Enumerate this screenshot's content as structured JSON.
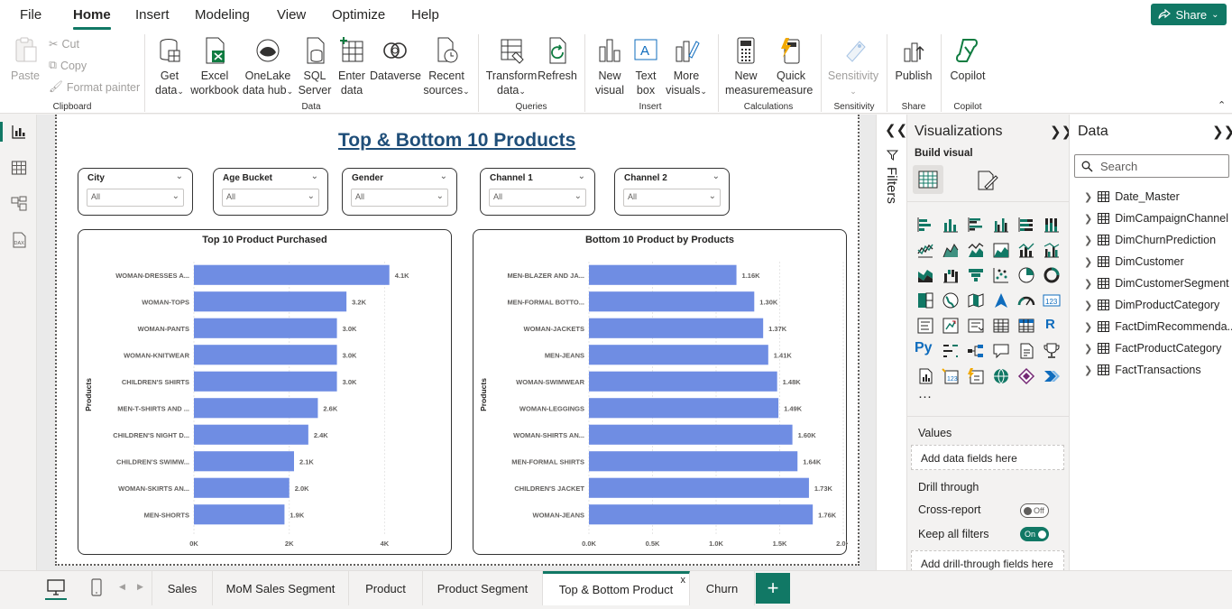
{
  "menu": {
    "items": [
      "File",
      "Home",
      "Insert",
      "Modeling",
      "View",
      "Optimize",
      "Help"
    ],
    "active": "Home",
    "share_label": "Share"
  },
  "ribbon": {
    "clipboard": {
      "paste": "Paste",
      "cut": "Cut",
      "copy": "Copy",
      "format_painter": "Format painter",
      "group": "Clipboard"
    },
    "data": {
      "get_data": [
        "Get",
        "data"
      ],
      "excel": [
        "Excel",
        "workbook"
      ],
      "onelake": [
        "OneLake",
        "data hub"
      ],
      "sql": [
        "SQL",
        "Server"
      ],
      "enter": [
        "Enter",
        "data"
      ],
      "dataverse": "Dataverse",
      "recent": [
        "Recent",
        "sources"
      ],
      "group": "Data"
    },
    "queries": {
      "transform": [
        "Transform",
        "data"
      ],
      "refresh": "Refresh",
      "group": "Queries"
    },
    "insert": {
      "new_visual": [
        "New",
        "visual"
      ],
      "text_box": [
        "Text",
        "box"
      ],
      "more_visuals": [
        "More",
        "visuals"
      ],
      "group": "Insert"
    },
    "calculations": {
      "new_measure": [
        "New",
        "measure"
      ],
      "quick_measure": [
        "Quick",
        "measure"
      ],
      "group": "Calculations"
    },
    "sensitivity": {
      "label": "Sensitivity",
      "group": "Sensitivity"
    },
    "share": {
      "publish": "Publish",
      "group": "Share"
    },
    "copilot": {
      "label": "Copilot",
      "group": "Copilot"
    }
  },
  "report": {
    "title": "Top & Bottom 10 Products",
    "slicers": [
      {
        "label": "City",
        "value": "All"
      },
      {
        "label": "Age Bucket",
        "value": "All"
      },
      {
        "label": "Gender",
        "value": "All"
      },
      {
        "label": "Channel 1",
        "value": "All"
      },
      {
        "label": "Channel 2",
        "value": "All"
      }
    ]
  },
  "chart_data": [
    {
      "type": "bar",
      "orientation": "horizontal",
      "title": "Top 10 Product Purchased",
      "ylabel": "Products",
      "xlabel": "",
      "categories": [
        "WOMAN-DRESSES A...",
        "WOMAN-TOPS",
        "WOMAN-PANTS",
        "WOMAN-KNITWEAR",
        "CHILDREN'S SHIRTS",
        "MEN-T-SHIRTS AND ...",
        "CHILDREN'S NIGHT D...",
        "CHILDREN'S SWIMW...",
        "WOMAN-SKIRTS AN...",
        "MEN-SHORTS"
      ],
      "values": [
        4100,
        3200,
        3000,
        3000,
        3000,
        2600,
        2400,
        2100,
        2000,
        1900
      ],
      "data_labels": [
        "4.1K",
        "3.2K",
        "3.0K",
        "3.0K",
        "3.0K",
        "2.6K",
        "2.4K",
        "2.1K",
        "2.0K",
        "1.9K"
      ],
      "xlim": [
        0,
        4200
      ],
      "ticks": [
        0,
        2000,
        4000
      ],
      "tick_labels": [
        "0K",
        "2K",
        "4K"
      ],
      "color": "#6f8de3"
    },
    {
      "type": "bar",
      "orientation": "horizontal",
      "title": "Bottom 10 Product by Products",
      "ylabel": "Products",
      "xlabel": "",
      "categories": [
        "MEN-BLAZER AND JA...",
        "MEN-FORMAL BOTTO...",
        "WOMAN-JACKETS",
        "MEN-JEANS",
        "WOMAN-SWIMWEAR",
        "WOMAN-LEGGINGS",
        "WOMAN-SHIRTS AN...",
        "MEN-FORMAL SHIRTS",
        "CHILDREN'S JACKET",
        "WOMAN-JEANS"
      ],
      "values": [
        1160,
        1300,
        1370,
        1410,
        1480,
        1490,
        1600,
        1640,
        1730,
        1760
      ],
      "data_labels": [
        "1.16K",
        "1.30K",
        "1.37K",
        "1.41K",
        "1.48K",
        "1.49K",
        "1.60K",
        "1.64K",
        "1.73K",
        "1.76K"
      ],
      "xlim": [
        0,
        2000
      ],
      "ticks": [
        0,
        500,
        1000,
        1500,
        2000
      ],
      "tick_labels": [
        "0.0K",
        "0.5K",
        "1.0K",
        "1.5K",
        "2.0K"
      ],
      "color": "#6f8de3"
    }
  ],
  "filters": {
    "label": "Filters"
  },
  "visualizations": {
    "title": "Visualizations",
    "build_visual": "Build visual",
    "more": "···",
    "values_label": "Values",
    "values_zone": "Add data fields here",
    "drill_label": "Drill through",
    "cross_report": "Cross-report",
    "cross_report_state": "Off",
    "keep_filters": "Keep all filters",
    "keep_filters_state": "On",
    "drill_zone": "Add drill-through fields here"
  },
  "data_pane": {
    "title": "Data",
    "search_placeholder": "Search",
    "tables": [
      "Date_Master",
      "DimCampaignChannel",
      "DimChurnPrediction",
      "DimCustomer",
      "DimCustomerSegment",
      "DimProductCategory",
      "FactDimRecommenda...",
      "FactProductCategory",
      "FactTransactions"
    ]
  },
  "pages": {
    "tabs": [
      "Sales",
      "MoM Sales Segment",
      "Product",
      "Product Segment",
      "Top & Bottom Product",
      "Churn"
    ],
    "active": "Top & Bottom Product",
    "close": "x",
    "add": "+"
  }
}
